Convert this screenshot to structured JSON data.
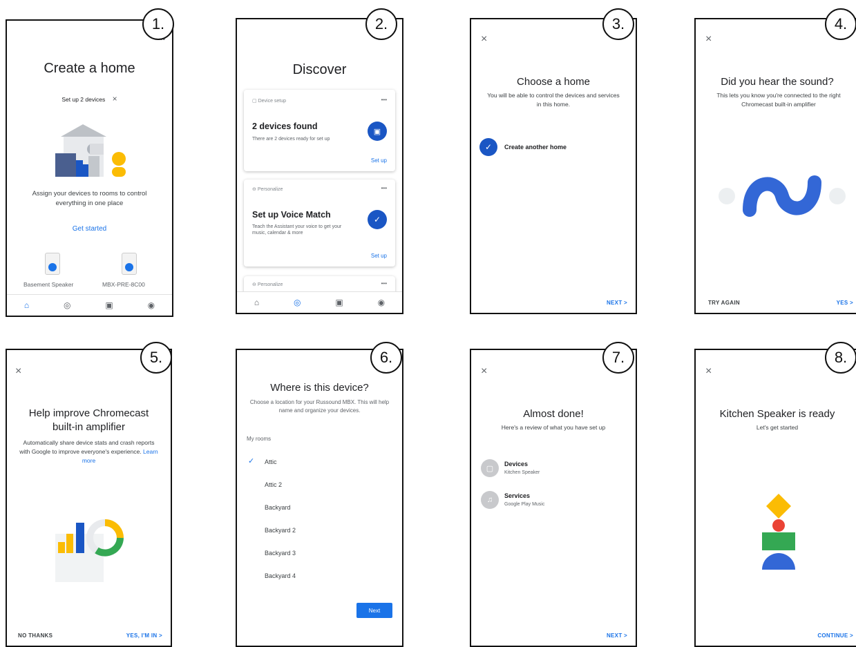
{
  "badges": [
    "1.",
    "2.",
    "3.",
    "4.",
    "5.",
    "6.",
    "7.",
    "8."
  ],
  "p1": {
    "title": "Create a home",
    "chip": "Set up 2 devices",
    "chip_close": "×",
    "desc": "Assign your devices to rooms to control everything in one place",
    "cta": "Get started",
    "devices": [
      "Basement Speaker",
      "MBX-PRE-8C00"
    ]
  },
  "p2": {
    "title": "Discover",
    "card1": {
      "tag": "Device setup",
      "heading": "2 devices found",
      "desc": "There are 2 devices ready for set up",
      "action": "Set up"
    },
    "card2": {
      "tag": "Personalize",
      "heading": "Set up Voice Match",
      "desc": "Teach the Assistant your voice to get your music, calendar & more",
      "action": "Set up"
    },
    "card3": {
      "tag": "Personalize"
    },
    "more": "•••"
  },
  "p3": {
    "close": "×",
    "title": "Choose a home",
    "desc": "You will be able to control the devices and services in this home.",
    "option": "Create another home",
    "next": "NEXT >"
  },
  "p4": {
    "close": "×",
    "title": "Did you hear the sound?",
    "desc": "This lets you know you're connected to the right Chromecast built-in amplifier",
    "try_again": "TRY AGAIN",
    "yes": "YES >"
  },
  "p5": {
    "close": "×",
    "title": "Help improve Chromecast built-in amplifier",
    "desc": "Automatically share device stats and crash reports with Google to improve everyone's experience.",
    "learn_more": "Learn more",
    "no_thanks": "NO THANKS",
    "yes": "YES, I'M IN >"
  },
  "p6": {
    "title": "Where is this device?",
    "desc": "Choose a location for your Russound MBX. This will help name and organize your devices.",
    "section": "My rooms",
    "rooms": [
      "Attic",
      "Attic 2",
      "Backyard",
      "Backyard 2",
      "Backyard 3",
      "Backyard 4"
    ],
    "selected_index": 0,
    "next": "Next"
  },
  "p7": {
    "close": "×",
    "title": "Almost done!",
    "desc": "Here's a review of what you have set up",
    "items": [
      {
        "label": "Devices",
        "sub": "Kitchen Speaker"
      },
      {
        "label": "Services",
        "sub": "Google Play Music"
      }
    ],
    "next": "NEXT >"
  },
  "p8": {
    "close": "×",
    "title": "Kitchen Speaker is ready",
    "desc": "Let's get started",
    "continue": "CONTINUE >"
  },
  "colors": {
    "accent": "#1a73e8",
    "dark_blue": "#1a56c4",
    "yellow": "#fbbc04",
    "red": "#ea4335",
    "green": "#34a853"
  }
}
